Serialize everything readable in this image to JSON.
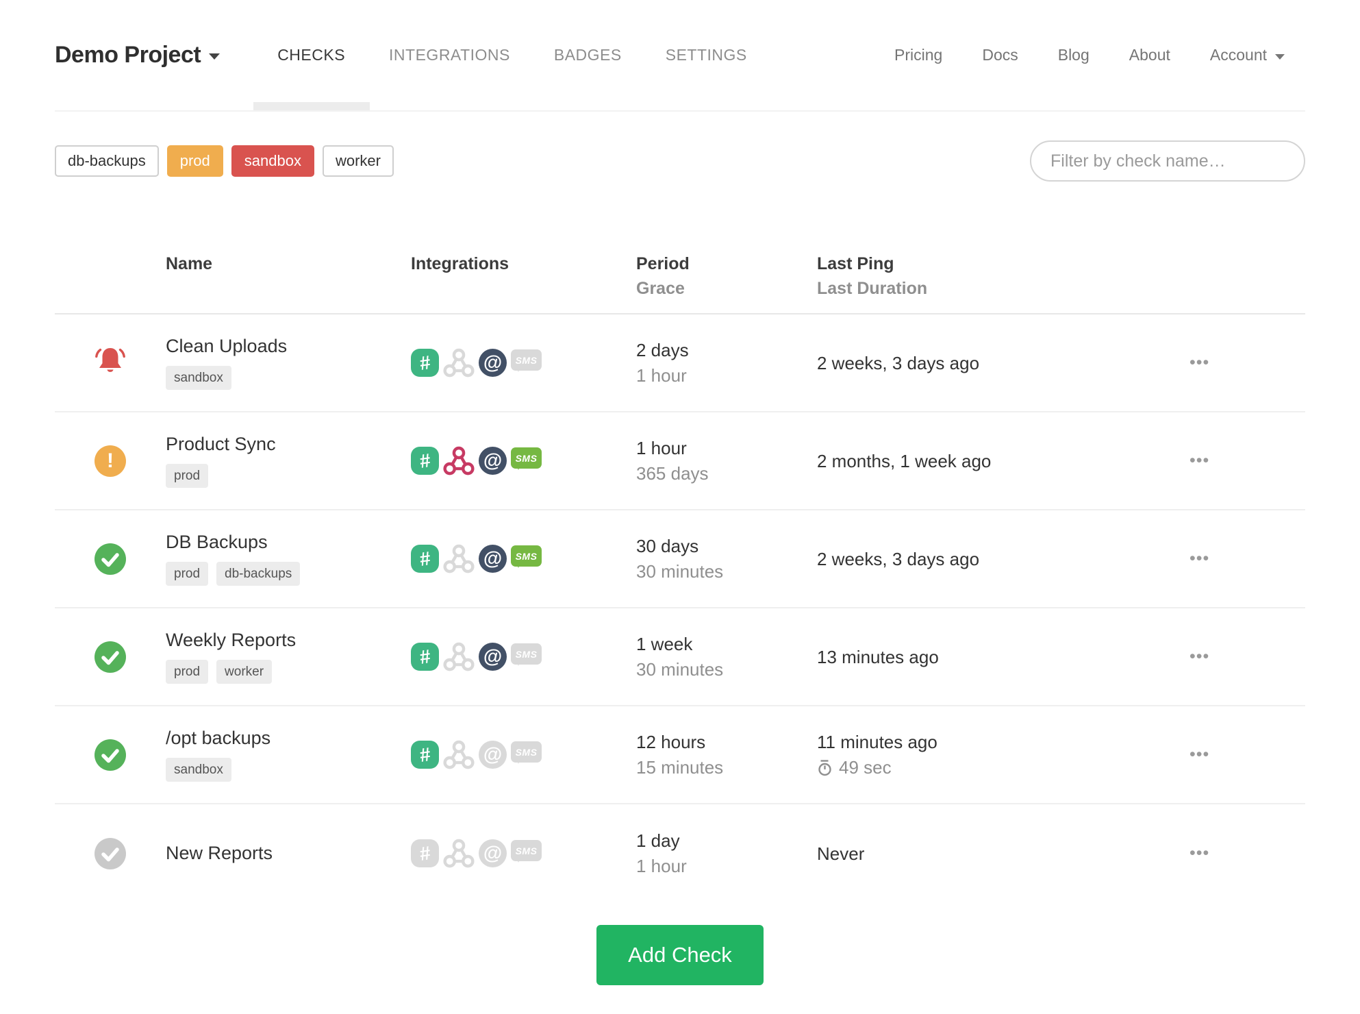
{
  "nav": {
    "project_label": "Demo Project",
    "tabs": [
      {
        "label": "CHECKS",
        "active": true
      },
      {
        "label": "INTEGRATIONS",
        "active": false
      },
      {
        "label": "BADGES",
        "active": false
      },
      {
        "label": "SETTINGS",
        "active": false
      }
    ],
    "links": [
      "Pricing",
      "Docs",
      "Blog",
      "About"
    ],
    "account_label": "Account"
  },
  "filters": {
    "tags": [
      {
        "label": "db-backups",
        "variant": "outline"
      },
      {
        "label": "prod",
        "variant": "orange"
      },
      {
        "label": "sandbox",
        "variant": "red"
      },
      {
        "label": "worker",
        "variant": "outline"
      }
    ],
    "search_placeholder": "Filter by check name…"
  },
  "table": {
    "headers": {
      "name": "Name",
      "integrations": "Integrations",
      "period": "Period",
      "grace": "Grace",
      "last_ping": "Last Ping",
      "last_duration": "Last Duration"
    },
    "row_menu_label": "•••",
    "rows": [
      {
        "status": "alert",
        "name": "Clean Uploads",
        "tags": [
          "sandbox"
        ],
        "integrations": {
          "slack": true,
          "webhook": false,
          "email": true,
          "sms": false
        },
        "period": "2 days",
        "grace": "1 hour",
        "last_ping": "2 weeks, 3 days ago",
        "last_duration": ""
      },
      {
        "status": "grace",
        "name": "Product Sync",
        "tags": [
          "prod"
        ],
        "integrations": {
          "slack": true,
          "webhook": true,
          "email": true,
          "sms": true
        },
        "period": "1 hour",
        "grace": "365 days",
        "last_ping": "2 months, 1 week ago",
        "last_duration": ""
      },
      {
        "status": "up",
        "name": "DB Backups",
        "tags": [
          "prod",
          "db-backups"
        ],
        "integrations": {
          "slack": true,
          "webhook": false,
          "email": true,
          "sms": true
        },
        "period": "30 days",
        "grace": "30 minutes",
        "last_ping": "2 weeks, 3 days ago",
        "last_duration": ""
      },
      {
        "status": "up",
        "name": "Weekly Reports",
        "tags": [
          "prod",
          "worker"
        ],
        "integrations": {
          "slack": true,
          "webhook": false,
          "email": true,
          "sms": false
        },
        "period": "1 week",
        "grace": "30 minutes",
        "last_ping": "13 minutes ago",
        "last_duration": ""
      },
      {
        "status": "up",
        "name": "/opt backups",
        "tags": [
          "sandbox"
        ],
        "integrations": {
          "slack": true,
          "webhook": false,
          "email": false,
          "sms": false
        },
        "period": "12 hours",
        "grace": "15 minutes",
        "last_ping": "11 minutes ago",
        "last_duration": "49 sec"
      },
      {
        "status": "new",
        "name": "New Reports",
        "tags": [],
        "integrations": {
          "slack": false,
          "webhook": false,
          "email": false,
          "sms": false
        },
        "period": "1 day",
        "grace": "1 hour",
        "last_ping": "Never",
        "last_duration": ""
      }
    ]
  },
  "add_check_label": "Add Check",
  "colors": {
    "status_alert": "#d9534f",
    "status_grace": "#f0ad4e",
    "status_up": "#55b25a",
    "status_new": "#c9c9c9",
    "slack": "#3eb582",
    "webhook": "#c73a63",
    "email": "#425066",
    "sms": "#76b842",
    "inactive_icon": "#d9d9d9",
    "tag_orange": "#f0ad4e",
    "tag_red": "#d9534f",
    "add_check_green": "#21b462"
  }
}
